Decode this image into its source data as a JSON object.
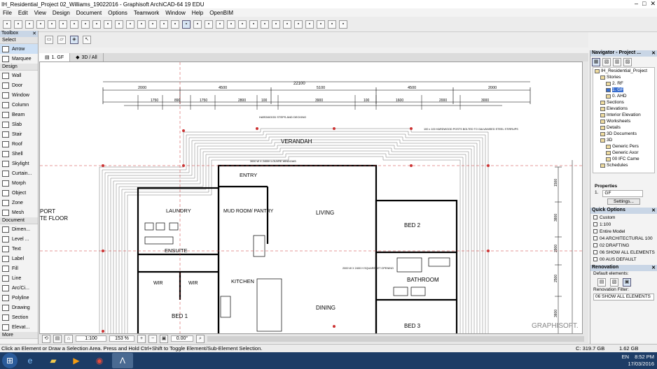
{
  "window": {
    "title": "IH_Residential_Project 02_Williams_19022016 - Graphisoft ArchiCAD-64 19 EDU"
  },
  "menu": [
    "File",
    "Edit",
    "View",
    "Design",
    "Document",
    "Options",
    "Teamwork",
    "Window",
    "Help",
    "OpenBIM"
  ],
  "toolbox": {
    "title": "Toolbox",
    "select_label": "Select",
    "select_tools": [
      {
        "label": "Arrow",
        "icon": "arrow-icon"
      },
      {
        "label": "Marquee",
        "icon": "marquee-icon"
      }
    ],
    "design_label": "Design",
    "design_tools": [
      {
        "label": "Wall",
        "icon": "wall-icon"
      },
      {
        "label": "Door",
        "icon": "door-icon"
      },
      {
        "label": "Window",
        "icon": "window-icon"
      },
      {
        "label": "Column",
        "icon": "column-icon"
      },
      {
        "label": "Beam",
        "icon": "beam-icon"
      },
      {
        "label": "Slab",
        "icon": "slab-icon"
      },
      {
        "label": "Stair",
        "icon": "stair-icon"
      },
      {
        "label": "Roof",
        "icon": "roof-icon"
      },
      {
        "label": "Shell",
        "icon": "shell-icon"
      },
      {
        "label": "Skylight",
        "icon": "skylight-icon"
      },
      {
        "label": "Curtain...",
        "icon": "curtain-wall-icon"
      },
      {
        "label": "Morph",
        "icon": "morph-icon"
      },
      {
        "label": "Object",
        "icon": "object-icon"
      },
      {
        "label": "Zone",
        "icon": "zone-icon"
      },
      {
        "label": "Mesh",
        "icon": "mesh-icon"
      }
    ],
    "document_label": "Document",
    "document_tools": [
      {
        "label": "Dimen...",
        "icon": "dimension-icon"
      },
      {
        "label": "Level ...",
        "icon": "level-dimension-icon"
      },
      {
        "label": "Text",
        "icon": "text-icon"
      },
      {
        "label": "Label",
        "icon": "label-icon"
      },
      {
        "label": "Fill",
        "icon": "fill-icon"
      },
      {
        "label": "Line",
        "icon": "line-icon"
      },
      {
        "label": "Arc/Ci...",
        "icon": "arc-icon"
      },
      {
        "label": "Polyline",
        "icon": "polyline-icon"
      },
      {
        "label": "Drawing",
        "icon": "drawing-icon"
      },
      {
        "label": "Section",
        "icon": "section-icon"
      },
      {
        "label": "Elevat...",
        "icon": "elevation-icon"
      }
    ],
    "more_label": "More"
  },
  "tabs": [
    {
      "label": "1. GF",
      "icon": "floorplan-icon"
    },
    {
      "label": "3D / All",
      "icon": "3d-icon"
    }
  ],
  "plan": {
    "overall_dim": "22100",
    "dims_top": [
      "2000",
      "4500",
      "5100",
      "4500",
      "2000"
    ],
    "dims_second": [
      "1750",
      "890",
      "1750",
      "2800",
      "100",
      "3900",
      "100",
      "1600",
      "2000",
      "3000"
    ],
    "rooms": [
      "VERANDAH",
      "ENTRY",
      "LAUNDRY",
      "MUD ROOM/ PANTRY",
      "LIVING",
      "BED 2",
      "ENSUITE",
      "WIR",
      "WIR",
      "KITCHEN",
      "BATHROOM",
      "DINING",
      "BED 1",
      "BED 3",
      "PORT",
      "TE FLOOR"
    ],
    "notes": [
      "HARDWOOD STEPS AND DECKING",
      "3000 W X 2400H LOUVRE WINDOWS",
      "100 x 100 HARDWOOD POSTS BOLTED TO GALVANISED STEEL STIRRUPS",
      "2000 W X 2400 H SQUARESET OPENING"
    ],
    "side_dims": [
      "1500",
      "3800",
      "2900",
      "2500",
      "3600"
    ],
    "watermark": "GRAPHISOFT."
  },
  "bottom": {
    "scale": "1:100",
    "zoom": "153 %",
    "angle": "0.00°"
  },
  "navigator": {
    "title": "Navigator - Project ...",
    "tree": [
      {
        "label": "IH_Residential_Project",
        "indent": 0
      },
      {
        "label": "Stories",
        "indent": 1
      },
      {
        "label": "2. RF",
        "indent": 2
      },
      {
        "label": "1. GF",
        "indent": 2,
        "selected": true
      },
      {
        "label": "0. AHD",
        "indent": 2
      },
      {
        "label": "Sections",
        "indent": 1
      },
      {
        "label": "Elevations",
        "indent": 1
      },
      {
        "label": "Interior Elevation",
        "indent": 1
      },
      {
        "label": "Worksheets",
        "indent": 1
      },
      {
        "label": "Details",
        "indent": 1
      },
      {
        "label": "3D Documents",
        "indent": 1
      },
      {
        "label": "3D",
        "indent": 1
      },
      {
        "label": "Generic Pers",
        "indent": 2
      },
      {
        "label": "Generic Axor",
        "indent": 2
      },
      {
        "label": "00 IFC Came",
        "indent": 2
      },
      {
        "label": "Schedules",
        "indent": 1
      }
    ],
    "properties_label": "Properties",
    "prop_number": "1.",
    "prop_name": "GF",
    "settings_label": "Settings..."
  },
  "quick_options": {
    "title": "Quick Options",
    "rows": [
      "Custom",
      "1:100",
      "Entire Model",
      "04 ARCHITECTURAL 100",
      "02 DRAFTING",
      "06 SHOW ALL ELEMENTS",
      "00 AUS DEFAULT"
    ]
  },
  "renovation": {
    "title": "Renovation",
    "default_label": "Default elements:",
    "filter_label": "Renovation Filter:",
    "filter_value": "06 SHOW ALL ELEMENTS"
  },
  "status": {
    "text": "Click an Element or Draw a Selection Area. Press and Hold Ctrl+Shift to Toggle Element/Sub-Element Selection.",
    "disk": "C: 319.7 GB",
    "ram": "1.62 GB"
  },
  "taskbar": {
    "lang": "EN",
    "time": "8:52 PM",
    "date": "17/03/2016"
  },
  "colors": {
    "selection": "#3a6fcf",
    "taskbar": "#1c3c66",
    "wall": "#000000",
    "dim_red": "#cc2222"
  }
}
